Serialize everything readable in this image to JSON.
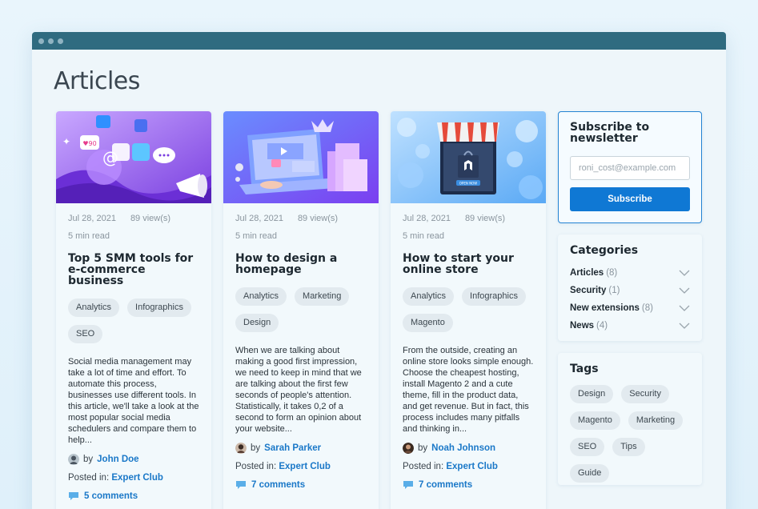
{
  "page": {
    "title": "Articles"
  },
  "articles": [
    {
      "date": "Jul 28, 2021",
      "views": "89 view(s)",
      "read_time": "5 min read",
      "title": "Top 5 SMM tools for e-commerce business",
      "tags": [
        "Analytics",
        "Infographics",
        "SEO"
      ],
      "excerpt": "Social media management may take a lot of time and effort. To automate this process, businesses use different tools. In this article, we'll take a look at the most popular social media schedulers and compare them to help...",
      "by": "by",
      "author": "John Doe",
      "posted_in_label": "Posted in:",
      "category": "Expert Club",
      "comments": "5 comments"
    },
    {
      "date": "Jul 28, 2021",
      "views": "89 view(s)",
      "read_time": "5 min read",
      "title": "How to design a homepage",
      "tags": [
        "Analytics",
        "Marketing",
        "Design"
      ],
      "excerpt": "When we are talking about making a good first impression, we need to keep in mind that we are talking about the first few seconds of people's attention. Statistically, it takes 0,2 of a second to form an opinion about your website...",
      "by": "by",
      "author": "Sarah Parker",
      "posted_in_label": "Posted in:",
      "category": "Expert Club",
      "comments": "7 comments"
    },
    {
      "date": "Jul 28, 2021",
      "views": "89 view(s)",
      "read_time": "5 min read",
      "title": "How to start your online store",
      "tags": [
        "Analytics",
        "Infographics",
        "Magento"
      ],
      "excerpt": "From the outside, creating an online store looks simple enough. Choose the cheapest hosting, install Magento 2 and a cute theme, fill in the product data, and get revenue. But in fact, this process includes many pitfalls and thinking in...",
      "by": "by",
      "author": "Noah Johnson",
      "posted_in_label": "Posted in:",
      "category": "Expert Club",
      "comments": "7 comments"
    }
  ],
  "subscribe": {
    "title": "Subscribe to newsletter",
    "placeholder": "roni_cost@example.com",
    "button": "Subscribe"
  },
  "categories": {
    "title": "Categories",
    "items": [
      {
        "name": "Articles",
        "count": "(8)"
      },
      {
        "name": "Security",
        "count": "(1)"
      },
      {
        "name": "New extensions",
        "count": "(8)"
      },
      {
        "name": "News",
        "count": "(4)"
      }
    ]
  },
  "tags": {
    "title": "Tags",
    "items": [
      "Design",
      "Security",
      "Magento",
      "Marketing",
      "SEO",
      "Tips",
      "Guide"
    ]
  },
  "colors": {
    "accent": "#0f78d4",
    "link": "#1a78c8",
    "titlebar": "#2f6b80"
  }
}
